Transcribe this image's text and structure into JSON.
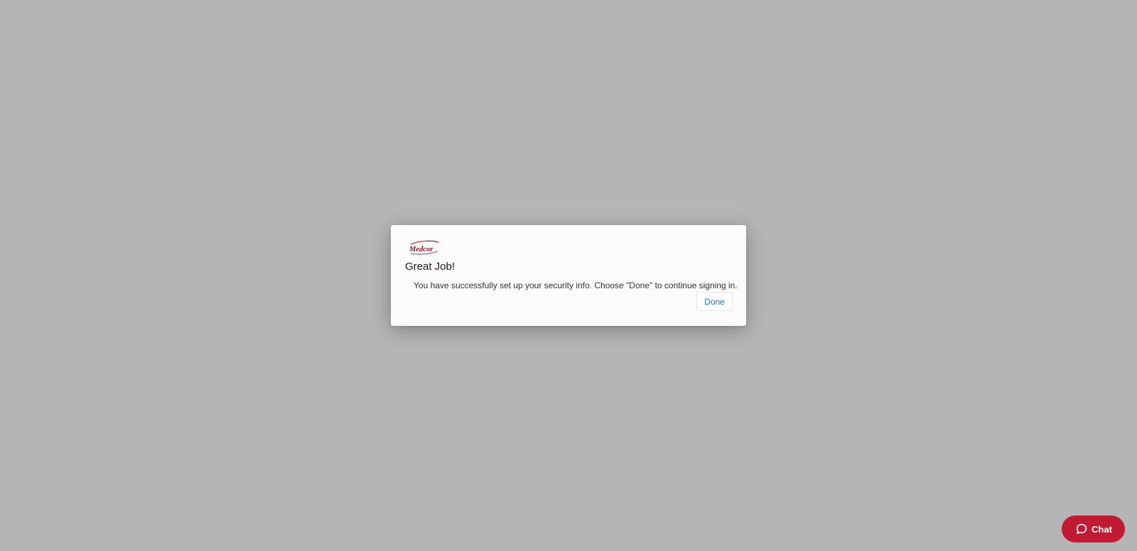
{
  "dialog": {
    "logo_text": "Medcor",
    "title": "Great Job!",
    "message": "You have successfully set up your security info. Choose \"Done\" to continue signing in.",
    "done_label": "Done"
  },
  "chat": {
    "label": "Chat",
    "icon": "chat-bubble-icon"
  },
  "colors": {
    "backdrop": "#b5b5b5",
    "dialog_bg": "#fbfbfb",
    "link_blue": "#1f76c9",
    "brand_red": "#c01b32",
    "logo_red": "#a0111f"
  }
}
